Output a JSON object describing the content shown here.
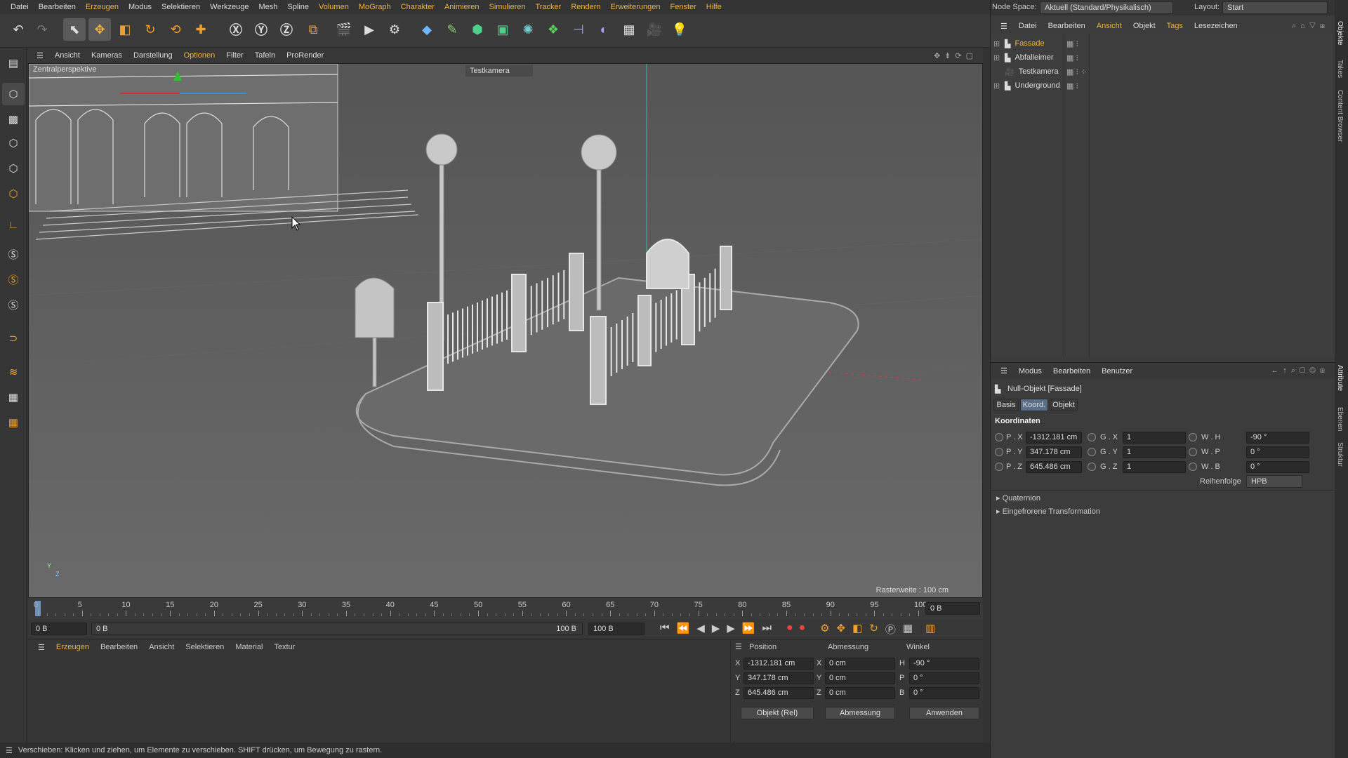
{
  "menubar": {
    "items": [
      "Datei",
      "Bearbeiten",
      "Erzeugen",
      "Modus",
      "Selektieren",
      "Werkzeuge",
      "Mesh",
      "Spline",
      "Volumen",
      "MoGraph",
      "Charakter",
      "Animieren",
      "Simulieren",
      "Tracker",
      "Rendern",
      "Erweiterungen",
      "Fenster",
      "Hilfe"
    ]
  },
  "viewport": {
    "menu": [
      "Ansicht",
      "Kameras",
      "Darstellung",
      "Optionen",
      "Filter",
      "Tafeln",
      "ProRender"
    ],
    "label": "Zentralperspektive",
    "camera": "Testkamera",
    "grid": "Rasterweite : 100 cm",
    "axis_y": "Y",
    "axis_z": "Z"
  },
  "timeline": {
    "ticks": [
      "0",
      "5",
      "10",
      "15",
      "20",
      "25",
      "30",
      "35",
      "40",
      "45",
      "50",
      "55",
      "60",
      "65",
      "70",
      "75",
      "80",
      "85",
      "90",
      "95",
      "100"
    ],
    "current": "0 B"
  },
  "transport": {
    "start": "0 B",
    "range_start": "0 B",
    "range_end": "100 B",
    "end": "100 B"
  },
  "materials": {
    "menu": [
      "Erzeugen",
      "Bearbeiten",
      "Ansicht",
      "Selektieren",
      "Material",
      "Textur"
    ]
  },
  "coords": {
    "headers": {
      "position": "Position",
      "abmessung": "Abmessung",
      "winkel": "Winkel"
    },
    "rows": [
      {
        "axis": "X",
        "pos": "-1312.181 cm",
        "dim_axis": "X",
        "dim": "0 cm",
        "ang_axis": "H",
        "ang": "-90 °"
      },
      {
        "axis": "Y",
        "pos": "347.178 cm",
        "dim_axis": "Y",
        "dim": "0 cm",
        "ang_axis": "P",
        "ang": "0 °"
      },
      {
        "axis": "Z",
        "pos": "645.486 cm",
        "dim_axis": "Z",
        "dim": "0 cm",
        "ang_axis": "B",
        "ang": "0 °"
      }
    ],
    "mode": "Objekt (Rel)",
    "size_mode": "Abmessung",
    "apply": "Anwenden"
  },
  "status": "Verschieben: Klicken und ziehen, um Elemente zu verschieben. SHIFT drücken, um Bewegung zu rastern.",
  "right": {
    "node_space_label": "Node Space:",
    "node_space_value": "Aktuell (Standard/Physikalisch)",
    "layout_label": "Layout:",
    "layout_value": "Start",
    "obj_menu": [
      "Datei",
      "Bearbeiten",
      "Ansicht",
      "Objekt",
      "Tags",
      "Lesezeichen"
    ],
    "objects": [
      "Fassade",
      "Abfalleimer",
      "Testkamera",
      "Underground"
    ],
    "attr_menu": [
      "Modus",
      "Bearbeiten",
      "Benutzer"
    ],
    "attr_title": "Null-Objekt [Fassade]",
    "attr_tabs": [
      "Basis",
      "Koord.",
      "Objekt"
    ],
    "section": "Koordinaten",
    "p": [
      {
        "l": "P . X",
        "v": "-1312.181 cm"
      },
      {
        "l": "P . Y",
        "v": "347.178 cm"
      },
      {
        "l": "P . Z",
        "v": "645.486 cm"
      }
    ],
    "g": [
      {
        "l": "G . X",
        "v": "1"
      },
      {
        "l": "G . Y",
        "v": "1"
      },
      {
        "l": "G . Z",
        "v": "1"
      }
    ],
    "w": [
      {
        "l": "W . H",
        "v": "-90 °"
      },
      {
        "l": "W . P",
        "v": "0 °"
      },
      {
        "l": "W . B",
        "v": "0 °"
      }
    ],
    "order_label": "Reihenfolge",
    "order_value": "HPB",
    "quaternion": "Quaternion",
    "frozen": "Eingefrorene Transformation",
    "vtabs": [
      "Objekte",
      "Takes",
      "Content Browser",
      "Attribute",
      "Ebenen",
      "Struktur"
    ]
  },
  "colors": {
    "accent": "#f0b43c",
    "viewport_bg": "#5f5f5f"
  }
}
